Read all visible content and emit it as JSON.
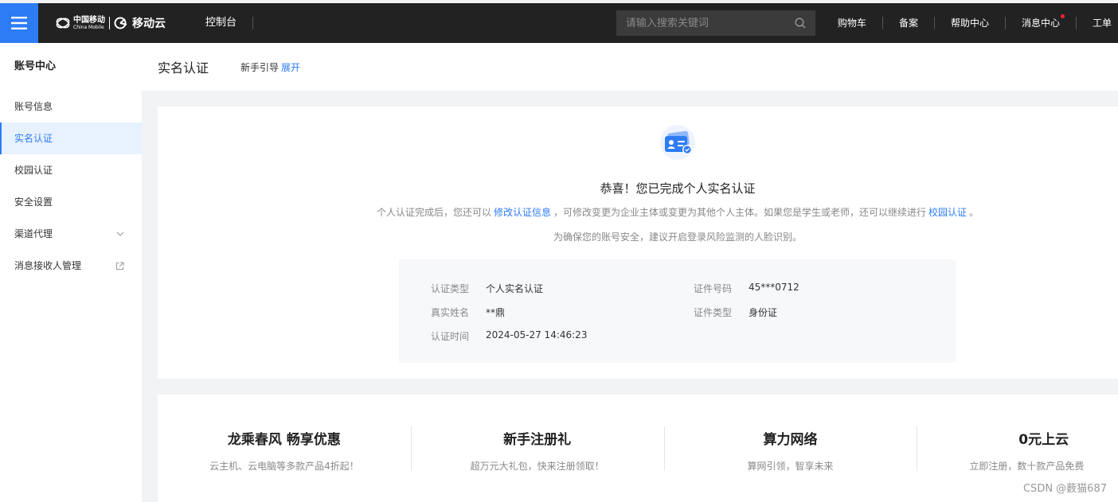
{
  "topbar": {
    "brand_cn": "中国移动",
    "brand_en": "China Mobile",
    "product": "移动云",
    "console": "控制台",
    "search_placeholder": "请输入搜索关键词",
    "nav": [
      "购物车",
      "备案",
      "帮助中心",
      "消息中心",
      "工单"
    ]
  },
  "sidebar": {
    "title": "账号中心",
    "items": [
      {
        "label": "账号信息"
      },
      {
        "label": "实名认证"
      },
      {
        "label": "校园认证"
      },
      {
        "label": "安全设置"
      },
      {
        "label": "渠道代理"
      },
      {
        "label": "消息接收人管理"
      }
    ]
  },
  "header": {
    "title": "实名认证",
    "guide_label": "新手引导",
    "guide_action": "展开"
  },
  "verification": {
    "title": "恭喜！您已完成个人实名认证",
    "line1_pre": "个人认证完成后，您还可以",
    "line1_link1": "修改认证信息",
    "line1_mid": "，可修改变更为企业主体或变更为其他个人主体。如果您是学生或老师，还可以继续进行",
    "line1_link2": "校园认证",
    "line1_post": "。",
    "line2": "为确保您的账号安全，建议开启登录风险监测的人脸识别。",
    "fields": {
      "auth_type_label": "认证类型",
      "auth_type_value": "个人实名认证",
      "id_no_label": "证件号码",
      "id_no_value": "45***0712",
      "real_name_label": "真实姓名",
      "real_name_value": "**鼎",
      "id_type_label": "证件类型",
      "id_type_value": "身份证",
      "auth_time_label": "认证时间",
      "auth_time_value": "2024-05-27 14:46:23"
    }
  },
  "promos": [
    {
      "title": "龙乘春风 畅享优惠",
      "sub": "云主机、云电脑等多款产品4折起！"
    },
    {
      "title": "新手注册礼",
      "sub": "超万元大礼包，快来注册领取！"
    },
    {
      "title": "算力网络",
      "sub": "算网引领，智享未来"
    },
    {
      "title": "0元上云",
      "sub": "立即注册，数十款产品免费"
    }
  ],
  "watermark": "CSDN @薮猫687",
  "colors": {
    "accent": "#2d7cf6",
    "topbar": "#222222",
    "badge": "#f5222d"
  }
}
